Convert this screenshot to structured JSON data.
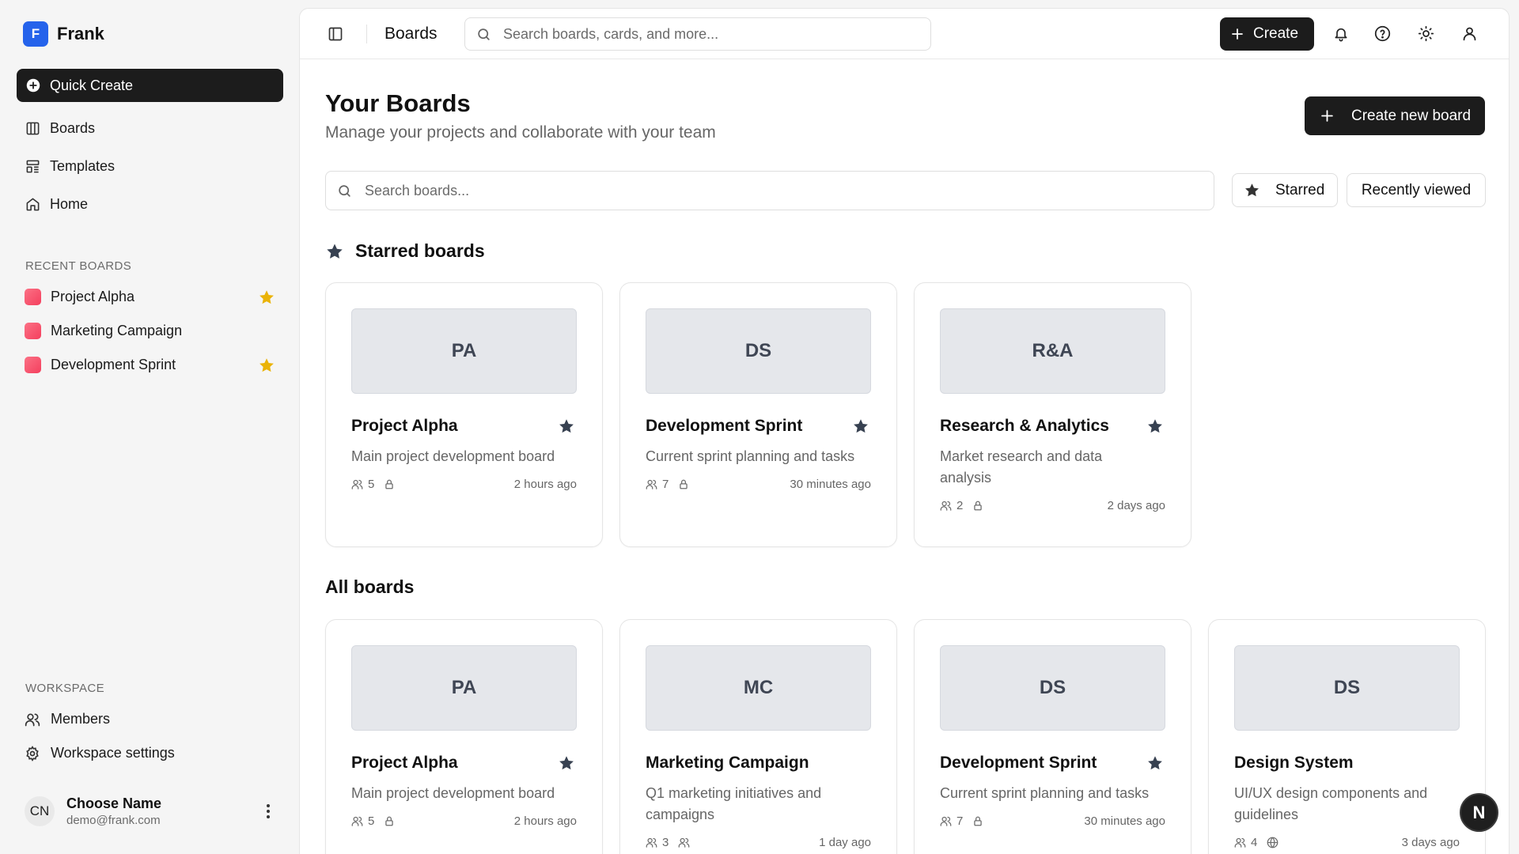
{
  "app": {
    "name": "Frank",
    "logo_letter": "F"
  },
  "sidebar": {
    "quick_create": "Quick Create",
    "nav": [
      {
        "label": "Boards",
        "icon": "columns-icon"
      },
      {
        "label": "Templates",
        "icon": "template-icon"
      },
      {
        "label": "Home",
        "icon": "home-icon"
      }
    ],
    "recent_label": "Recent boards",
    "recent": [
      {
        "label": "Project Alpha",
        "starred": true,
        "color": "#f43f5e"
      },
      {
        "label": "Marketing Campaign",
        "starred": false,
        "color": "#f43f5e"
      },
      {
        "label": "Development Sprint",
        "starred": true,
        "color": "#f43f5e"
      }
    ],
    "workspace_label": "Workspace",
    "workspace": [
      {
        "label": "Members",
        "icon": "users-icon"
      },
      {
        "label": "Workspace settings",
        "icon": "gear-icon"
      }
    ],
    "user": {
      "initials": "CN",
      "name": "Choose Name",
      "email": "demo@frank.com"
    }
  },
  "topbar": {
    "title": "Boards",
    "search_placeholder": "Search boards, cards, and more...",
    "create_label": "Create"
  },
  "main": {
    "title": "Your Boards",
    "subtitle": "Manage your projects and collaborate with your team",
    "new_board_label": "Create new board",
    "search_placeholder": "Search boards...",
    "filters": {
      "starred": "Starred",
      "recent": "Recently viewed"
    },
    "starred_heading": "Starred boards",
    "all_heading": "All boards",
    "starred_boards": [
      {
        "abbr": "PA",
        "title": "Project Alpha",
        "desc": "Main project development board",
        "members": "5",
        "visibility": "lock-icon",
        "time": "2 hours ago",
        "starred": true
      },
      {
        "abbr": "DS",
        "title": "Development Sprint",
        "desc": "Current sprint planning and tasks",
        "members": "7",
        "visibility": "lock-icon",
        "time": "30 minutes ago",
        "starred": true
      },
      {
        "abbr": "R&A",
        "title": "Research & Analytics",
        "desc": "Market research and data analysis",
        "members": "2",
        "visibility": "lock-icon",
        "time": "2 days ago",
        "starred": true
      }
    ],
    "all_boards": [
      {
        "abbr": "PA",
        "title": "Project Alpha",
        "desc": "Main project development board",
        "members": "5",
        "visibility": "lock-icon",
        "time": "2 hours ago",
        "starred": true
      },
      {
        "abbr": "MC",
        "title": "Marketing Campaign",
        "desc": "Q1 marketing initiatives and campaigns",
        "members": "3",
        "visibility": "users-icon",
        "time": "1 day ago",
        "starred": false
      },
      {
        "abbr": "DS",
        "title": "Development Sprint",
        "desc": "Current sprint planning and tasks",
        "members": "7",
        "visibility": "lock-icon",
        "time": "30 minutes ago",
        "starred": true
      },
      {
        "abbr": "DS",
        "title": "Design System",
        "desc": "UI/UX design components and guidelines",
        "members": "4",
        "visibility": "globe-icon",
        "time": "3 days ago",
        "starred": false
      }
    ]
  },
  "floating": {
    "letter": "N"
  }
}
